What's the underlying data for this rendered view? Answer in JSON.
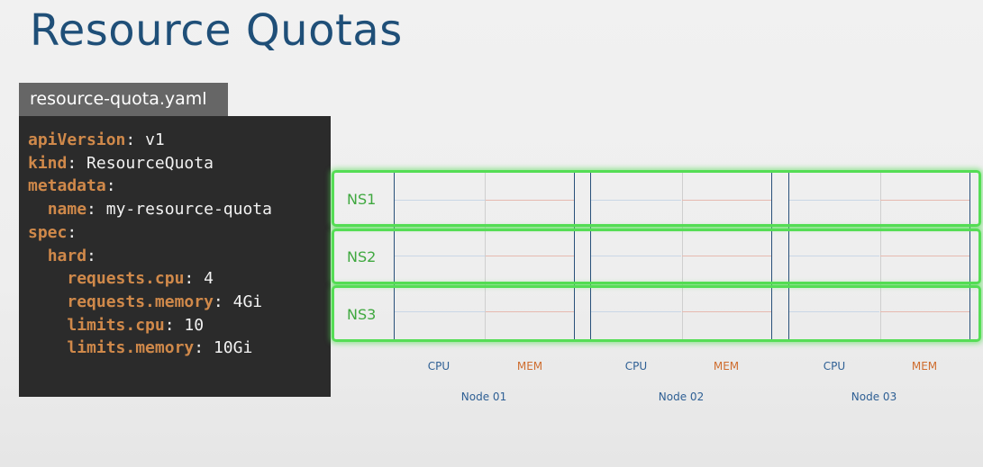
{
  "title": "Resource Quotas",
  "file": {
    "name": "resource-quota.yaml",
    "lines": [
      {
        "indent": "",
        "key": "apiVersion",
        "sep": ": ",
        "value": "v1"
      },
      {
        "indent": "",
        "key": "kind",
        "sep": ": ",
        "value": "ResourceQuota"
      },
      {
        "indent": "",
        "key": "metadata",
        "sep": ":",
        "value": ""
      },
      {
        "indent": "  ",
        "key": "name",
        "sep": ": ",
        "value": "my-resource-quota"
      },
      {
        "indent": "",
        "key": "spec",
        "sep": ":",
        "value": ""
      },
      {
        "indent": "  ",
        "key": "hard",
        "sep": ":",
        "value": ""
      },
      {
        "indent": "    ",
        "key": "requests.cpu",
        "sep": ": ",
        "value": "4"
      },
      {
        "indent": "    ",
        "key": "requests.memory",
        "sep": ": ",
        "value": "4Gi"
      },
      {
        "indent": "    ",
        "key": "limits.cpu",
        "sep": ": ",
        "value": "10"
      },
      {
        "indent": "    ",
        "key": "limits.memory",
        "sep": ": ",
        "value": "10Gi"
      }
    ]
  },
  "diagram": {
    "namespaces": [
      "NS1",
      "NS2",
      "NS3"
    ],
    "nodes": [
      "Node 01",
      "Node 02",
      "Node 03"
    ],
    "resources": {
      "cpu": "CPU",
      "mem": "MEM"
    },
    "colors": {
      "namespace": "#55dd55",
      "node_border": "#28507a",
      "cpu": "#2e5f94",
      "mem": "#cf6d2f",
      "code_key": "#d0894a"
    }
  }
}
